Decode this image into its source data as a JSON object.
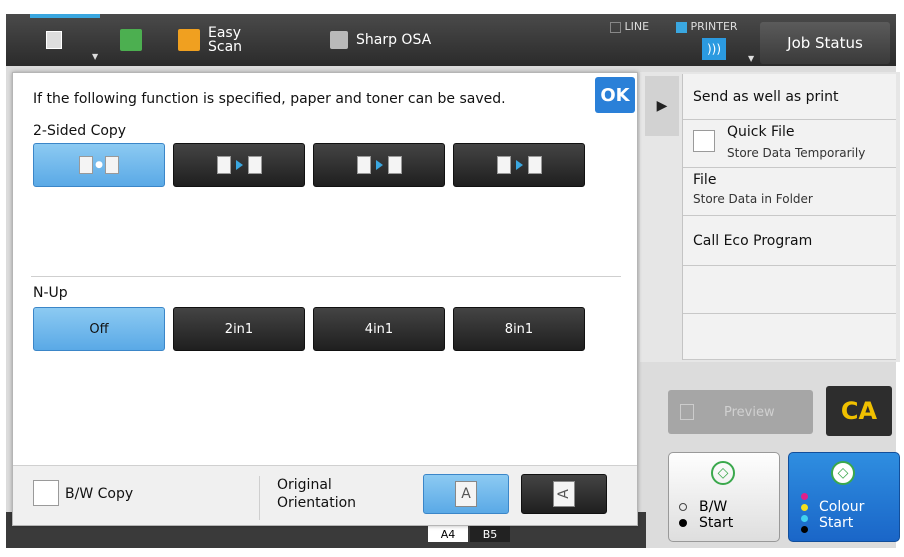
{
  "topbar": {
    "easy_scan_label": "Easy\nScan",
    "easy_scan_line1": "Easy",
    "easy_scan_line2": "Scan",
    "sharp_osa_label": "Sharp OSA",
    "line_label": "LINE",
    "printer_label": "PRINTER",
    "job_status_label": "Job Status"
  },
  "dialog": {
    "message": "If the following function is specified, paper and toner can be saved.",
    "ok_label": "OK",
    "two_sided": {
      "label": "2-Sided Copy",
      "options": [
        "1-sided to 1-sided",
        "1-sided to 2-sided",
        "2-sided to 2-sided",
        "2-sided to 1-sided"
      ],
      "selected": 0
    },
    "nup": {
      "label": "N-Up",
      "options": [
        "Off",
        "2in1",
        "4in1",
        "8in1"
      ],
      "selected": 0
    },
    "bw_copy_label": "B/W Copy",
    "orientation_label_1": "Original",
    "orientation_label_2": "Orientation",
    "orientation_portrait": "A",
    "orientation_landscape": "A"
  },
  "right_panel": {
    "items": [
      {
        "title": "Send as well as print"
      },
      {
        "title": "Quick File",
        "sub": "Store Data Temporarily"
      },
      {
        "title": "File",
        "sub": "Store Data in Folder"
      },
      {
        "title": "Call Eco Program"
      }
    ],
    "preview_label": "Preview",
    "ca_label": "CA"
  },
  "start": {
    "bw_line1": "B/W",
    "bw_line2": "Start",
    "colour_line1": "Colour",
    "colour_line2": "Start"
  },
  "paper_sizes": [
    "A4",
    "B5"
  ],
  "colors": {
    "accent": "#5aa9e6",
    "ok": "#2a80d8",
    "ca_text": "#f0c000",
    "colour_start": "#1a66c8"
  }
}
